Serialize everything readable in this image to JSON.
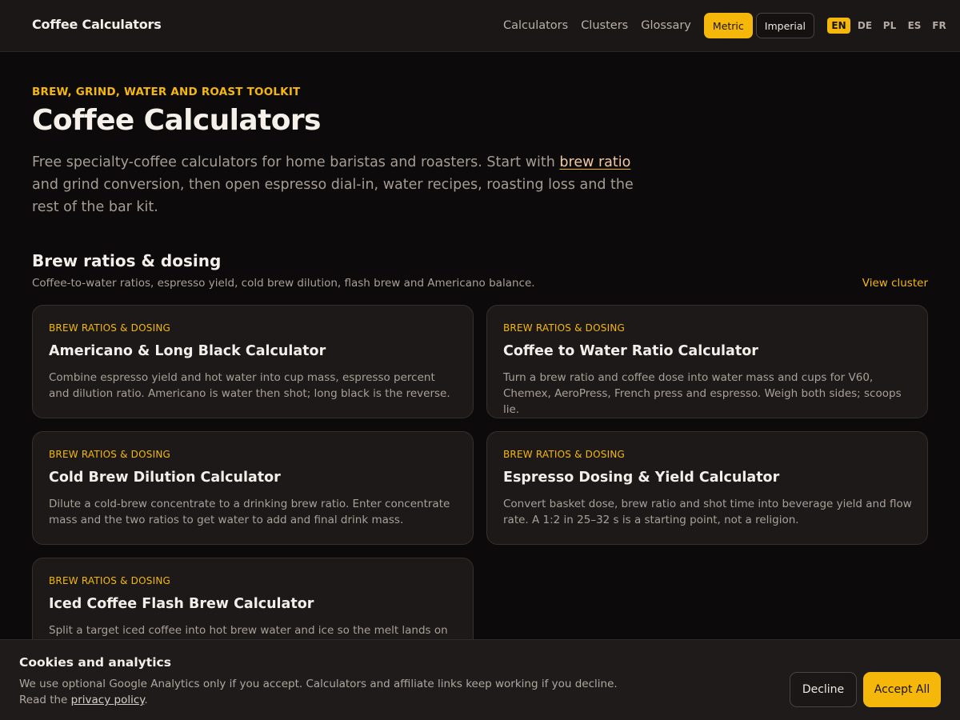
{
  "header": {
    "brand": "Coffee Calculators",
    "nav": [
      {
        "label": "Calculators"
      },
      {
        "label": "Clusters"
      },
      {
        "label": "Glossary"
      }
    ],
    "units": {
      "metric": "Metric",
      "imperial": "Imperial",
      "selected": "Metric"
    },
    "languages": [
      "EN",
      "DE",
      "PL",
      "ES",
      "FR"
    ],
    "selected_language": "EN"
  },
  "hero": {
    "eyebrow": "BREW, GRIND, WATER AND ROAST TOOLKIT",
    "title": "Coffee Calculators",
    "lead_before": "Free specialty-coffee calculators for home baristas and roasters. Start with ",
    "lead_link": "brew ratio",
    "lead_after": " and grind conversion, then open espresso dial-in, water recipes, roasting loss and the rest of the bar kit."
  },
  "section": {
    "title": "Brew ratios & dosing",
    "description": "Coffee-to-water ratios, espresso yield, cold brew dilution, flash brew and Americano balance.",
    "view_cluster": "View cluster",
    "cards": [
      {
        "tag": "BREW RATIOS & DOSING",
        "title": "Americano & Long Black Calculator",
        "description": "Combine espresso yield and hot water into cup mass, espresso percent and dilution ratio. Americano is water then shot; long black is the reverse."
      },
      {
        "tag": "BREW RATIOS & DOSING",
        "title": "Coffee to Water Ratio Calculator",
        "description": "Turn a brew ratio and coffee dose into water mass and cups for V60, Chemex, AeroPress, French press and espresso. Weigh both sides; scoops lie."
      },
      {
        "tag": "BREW RATIOS & DOSING",
        "title": "Cold Brew Dilution Calculator",
        "description": "Dilute a cold-brew concentrate to a drinking brew ratio. Enter concentrate mass and the two ratios to get water to add and final drink mass."
      },
      {
        "tag": "BREW RATIOS & DOSING",
        "title": "Espresso Dosing & Yield Calculator",
        "description": "Convert basket dose, brew ratio and shot time into beverage yield and flow rate. A 1:2 in 25–32 s is a starting point, not a religion."
      },
      {
        "tag": "BREW RATIOS & DOSING",
        "title": "Iced Coffee Flash Brew Calculator",
        "description": "Split a target iced coffee into hot brew water and ice so the melt lands on"
      }
    ]
  },
  "cookie": {
    "title": "Cookies and analytics",
    "text_before": "We use optional Google Analytics only if you accept. Calculators and affiliate links keep working if you decline. Read the ",
    "link": "privacy policy",
    "text_after": ".",
    "decline": "Decline",
    "accept": "Accept All"
  },
  "colors": {
    "accent": "#f5b80a",
    "background": "#0c0a0a",
    "card": "#1c1918"
  }
}
